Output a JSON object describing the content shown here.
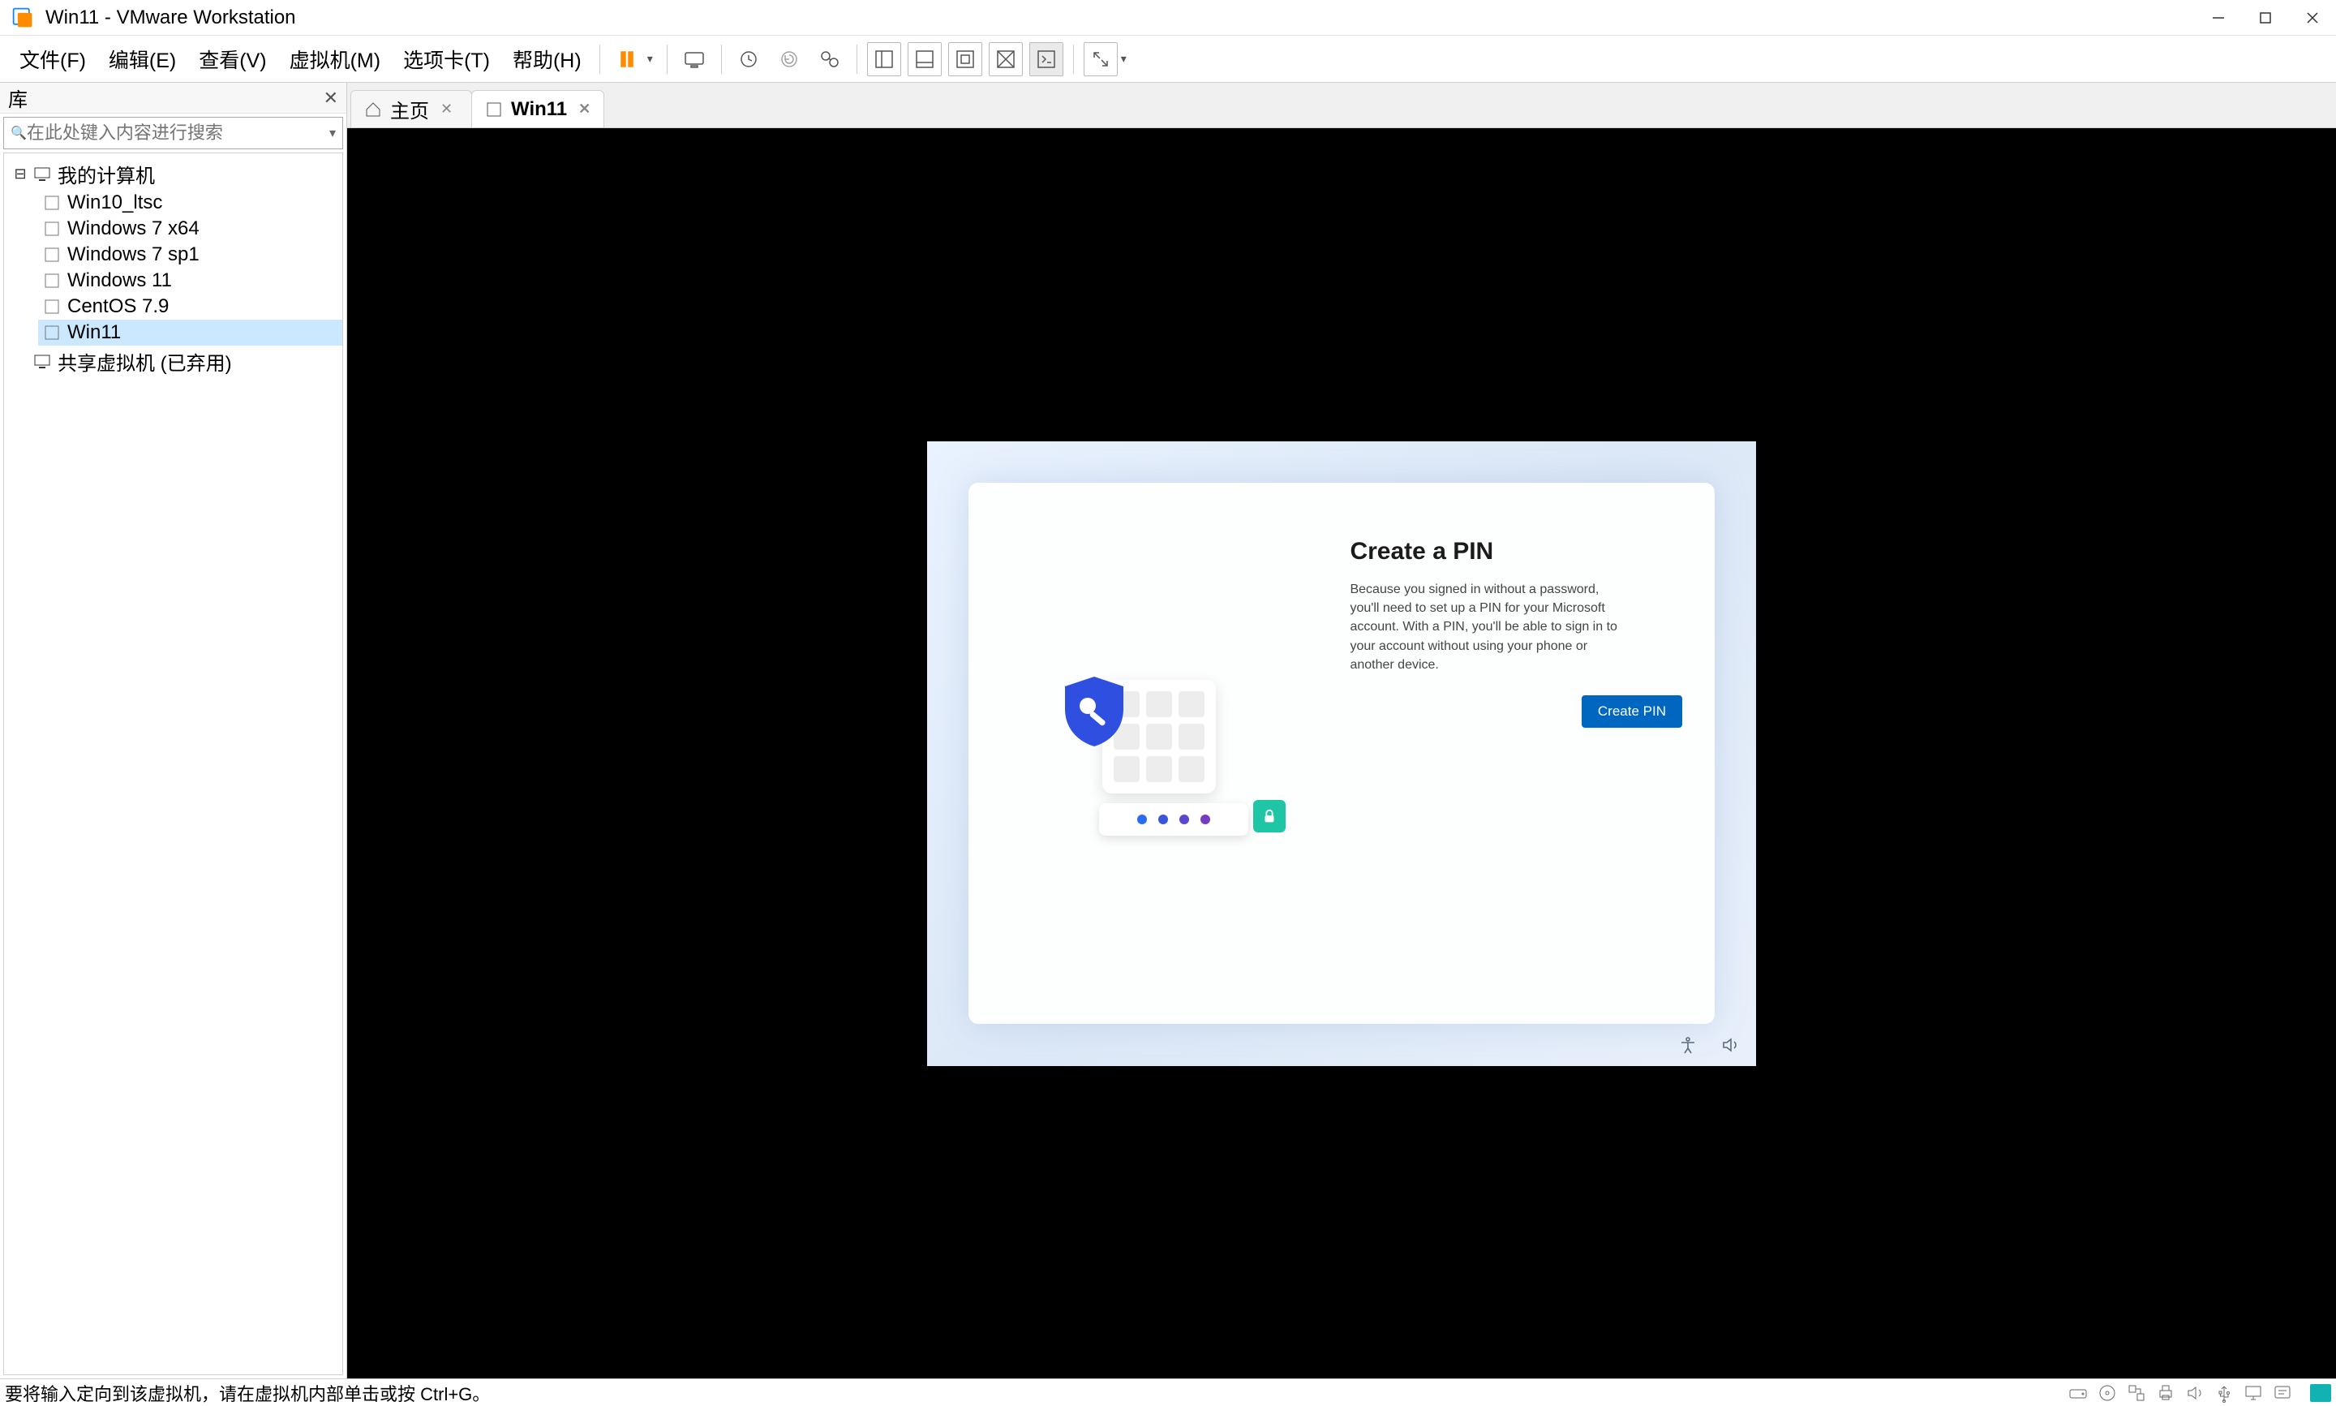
{
  "window": {
    "title": "Win11 - VMware Workstation"
  },
  "menu": {
    "file": "文件(F)",
    "edit": "编辑(E)",
    "view": "查看(V)",
    "vm": "虚拟机(M)",
    "tabs": "选项卡(T)",
    "help": "帮助(H)"
  },
  "library": {
    "title": "库",
    "search_placeholder": "在此处键入内容进行搜索",
    "root": "我的计算机",
    "shared": "共享虚拟机 (已弃用)",
    "vms": {
      "0": "Win10_ltsc",
      "1": "Windows 7 x64",
      "2": "Windows 7 sp1",
      "3": "Windows 11",
      "4": "CentOS 7.9",
      "5": "Win11"
    }
  },
  "tabs": {
    "home": "主页",
    "active": "Win11"
  },
  "oobe": {
    "title": "Create a PIN",
    "body": "Because you signed in without a password, you'll need to set up a PIN for your Microsoft account. With a PIN, you'll be able to sign in to your account without using your phone or another device.",
    "button": "Create PIN"
  },
  "statusbar": {
    "message": "要将输入定向到该虚拟机，请在虚拟机内部单击或按 Ctrl+G。"
  }
}
